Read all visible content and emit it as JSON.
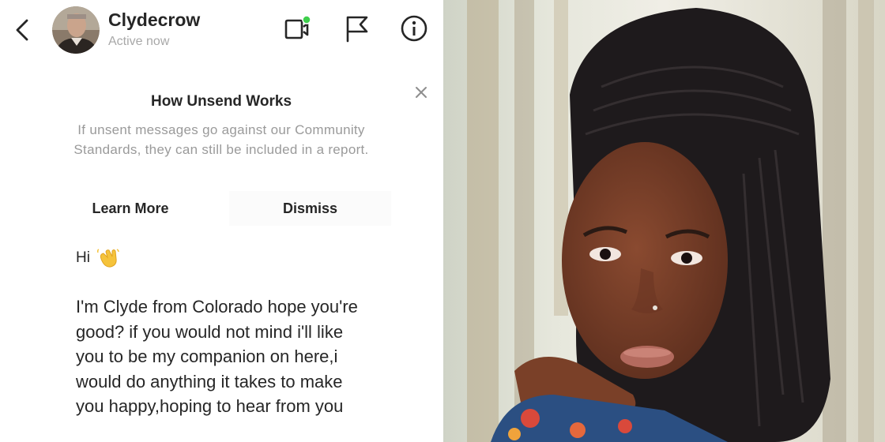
{
  "header": {
    "username": "Clydecrow",
    "status": "Active now",
    "icons": [
      "back-icon",
      "video-call-icon",
      "flag-icon",
      "info-icon"
    ],
    "online_indicator_color": "#3ecf4c"
  },
  "notice": {
    "title": "How Unsend Works",
    "body": "If unsent messages go against our Community Standards, they can still be included in a report.",
    "learn_more_label": "Learn More",
    "dismiss_label": "Dismiss",
    "close_icon": "close-icon"
  },
  "messages": [
    {
      "text": "Hi",
      "emoji": "waving-hand"
    },
    {
      "text": "I'm Clyde from Colorado hope you're good? if you would not mind i'll like you to be my companion on here,i would do anything it takes to make you happy,hoping to hear from you"
    }
  ],
  "colors": {
    "text_primary": "#262626",
    "text_secondary": "#a8a8a8"
  }
}
